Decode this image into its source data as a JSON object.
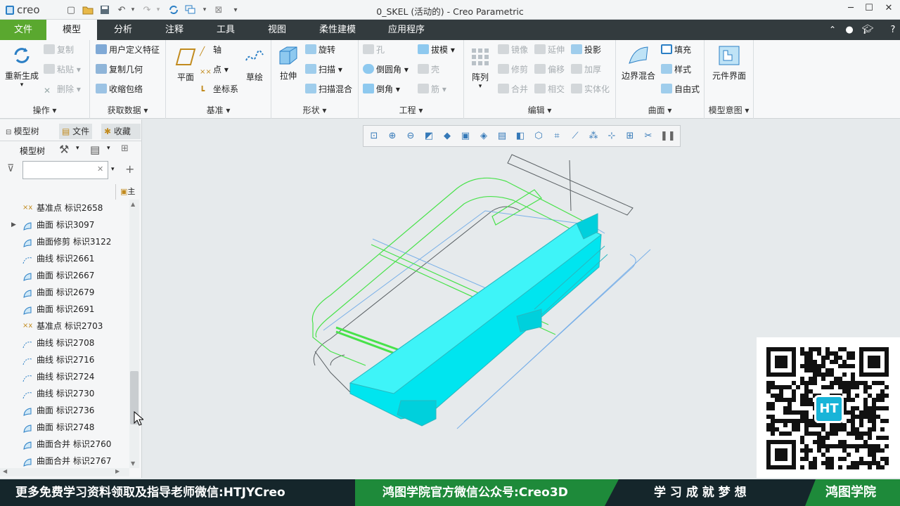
{
  "app": {
    "logo": "creo",
    "window_title": "0_SKEL (活动的) - Creo Parametric"
  },
  "colors": {
    "accent_green": "#5aa82f",
    "tabbar": "#333b3e",
    "footer_green": "#1e8a3a",
    "model_cyan": "#00e5ef"
  },
  "quick_access": [
    "new-icon",
    "open-icon",
    "save-icon",
    "undo-icon",
    "redo-icon",
    "regenerate-icon",
    "windows-icon",
    "close-icon",
    "customize-icon"
  ],
  "tabs": [
    {
      "label": "文件"
    },
    {
      "label": "模型"
    },
    {
      "label": "分析"
    },
    {
      "label": "注释"
    },
    {
      "label": "工具"
    },
    {
      "label": "视图"
    },
    {
      "label": "柔性建模"
    },
    {
      "label": "应用程序"
    }
  ],
  "ribbon": {
    "ops": {
      "regen": "重新生成",
      "copy": "复制",
      "paste": "粘贴",
      "delete": "删除",
      "label": "操作"
    },
    "getdata": {
      "udf": "用户定义特征",
      "copygeom": "复制几何",
      "shrinkwrap": "收缩包络",
      "label": "获取数据"
    },
    "datum": {
      "plane": "平面",
      "axis": "轴",
      "point": "点",
      "csys": "坐标系",
      "sketch": "草绘",
      "label": "基准"
    },
    "shapes": {
      "extrude": "拉伸",
      "revolve": "旋转",
      "sweep": "扫描",
      "sweptblend": "扫描混合",
      "label": "形状"
    },
    "engineering": {
      "hole": "孔",
      "draft": "拔模",
      "round": "倒圆角",
      "shell": "壳",
      "chamfer": "倒角",
      "rib": "筋",
      "label": "工程"
    },
    "editing": {
      "pattern": "阵列",
      "mirror": "镜像",
      "extend": "延伸",
      "project": "投影",
      "trim": "修剪",
      "offset": "偏移",
      "thicken": "加厚",
      "merge": "合并",
      "intersect": "相交",
      "solidify": "实体化",
      "label": "编辑"
    },
    "surfaces": {
      "boundary": "边界混合",
      "fill": "填充",
      "style": "样式",
      "freestyle": "自由式",
      "label": "曲面"
    },
    "intent": {
      "component": "元件界面",
      "label": "模型意图"
    }
  },
  "panel": {
    "tabs": [
      "模型树",
      "文件",
      "收藏"
    ],
    "toolbar_label": "模型树",
    "search_placeholder": "",
    "column_header": "主",
    "items": [
      {
        "label": "基准点 标识2658",
        "icon": "datum-point-icon"
      },
      {
        "label": "曲面 标识3097",
        "icon": "surface-icon",
        "expandable": true
      },
      {
        "label": "曲面修剪 标识3122",
        "icon": "trim-icon"
      },
      {
        "label": "曲线 标识2661",
        "icon": "curve-icon"
      },
      {
        "label": "曲面 标识2667",
        "icon": "surface-icon"
      },
      {
        "label": "曲面 标识2679",
        "icon": "surface-icon"
      },
      {
        "label": "曲面 标识2691",
        "icon": "surface-icon"
      },
      {
        "label": "基准点 标识2703",
        "icon": "datum-point-icon"
      },
      {
        "label": "曲线 标识2708",
        "icon": "curve-icon"
      },
      {
        "label": "曲线 标识2716",
        "icon": "curve-icon"
      },
      {
        "label": "曲线 标识2724",
        "icon": "curve-icon"
      },
      {
        "label": "曲线 标识2730",
        "icon": "curve-icon"
      },
      {
        "label": "曲面 标识2736",
        "icon": "surface-icon"
      },
      {
        "label": "曲面 标识2748",
        "icon": "surface-icon"
      },
      {
        "label": "曲面合并 标识2760",
        "icon": "merge-icon"
      },
      {
        "label": "曲面合并 标识2767",
        "icon": "merge-icon"
      }
    ]
  },
  "view_toolbar": [
    "refit-icon",
    "zoom-in-icon",
    "zoom-out-icon",
    "repaint-icon",
    "display-style-icon",
    "saved-orientations-icon",
    "view-manager-icon",
    "perspective-icon",
    "named-view-icon",
    "datum-display-icon",
    "plane-display-icon",
    "axis-display-icon",
    "point-display-icon",
    "csys-display-icon",
    "annotation-display-icon",
    "spin-center-icon",
    "pause-icon"
  ],
  "footer": {
    "left": "更多免费学习资料领取及指导老师微信:HTJYCreo",
    "mid": "鸿图学院官方微信公众号:Creo3D",
    "right": "学 习 成 就 梦 想",
    "brand": "鸿图学院"
  },
  "qr": {
    "badge": "HT"
  }
}
